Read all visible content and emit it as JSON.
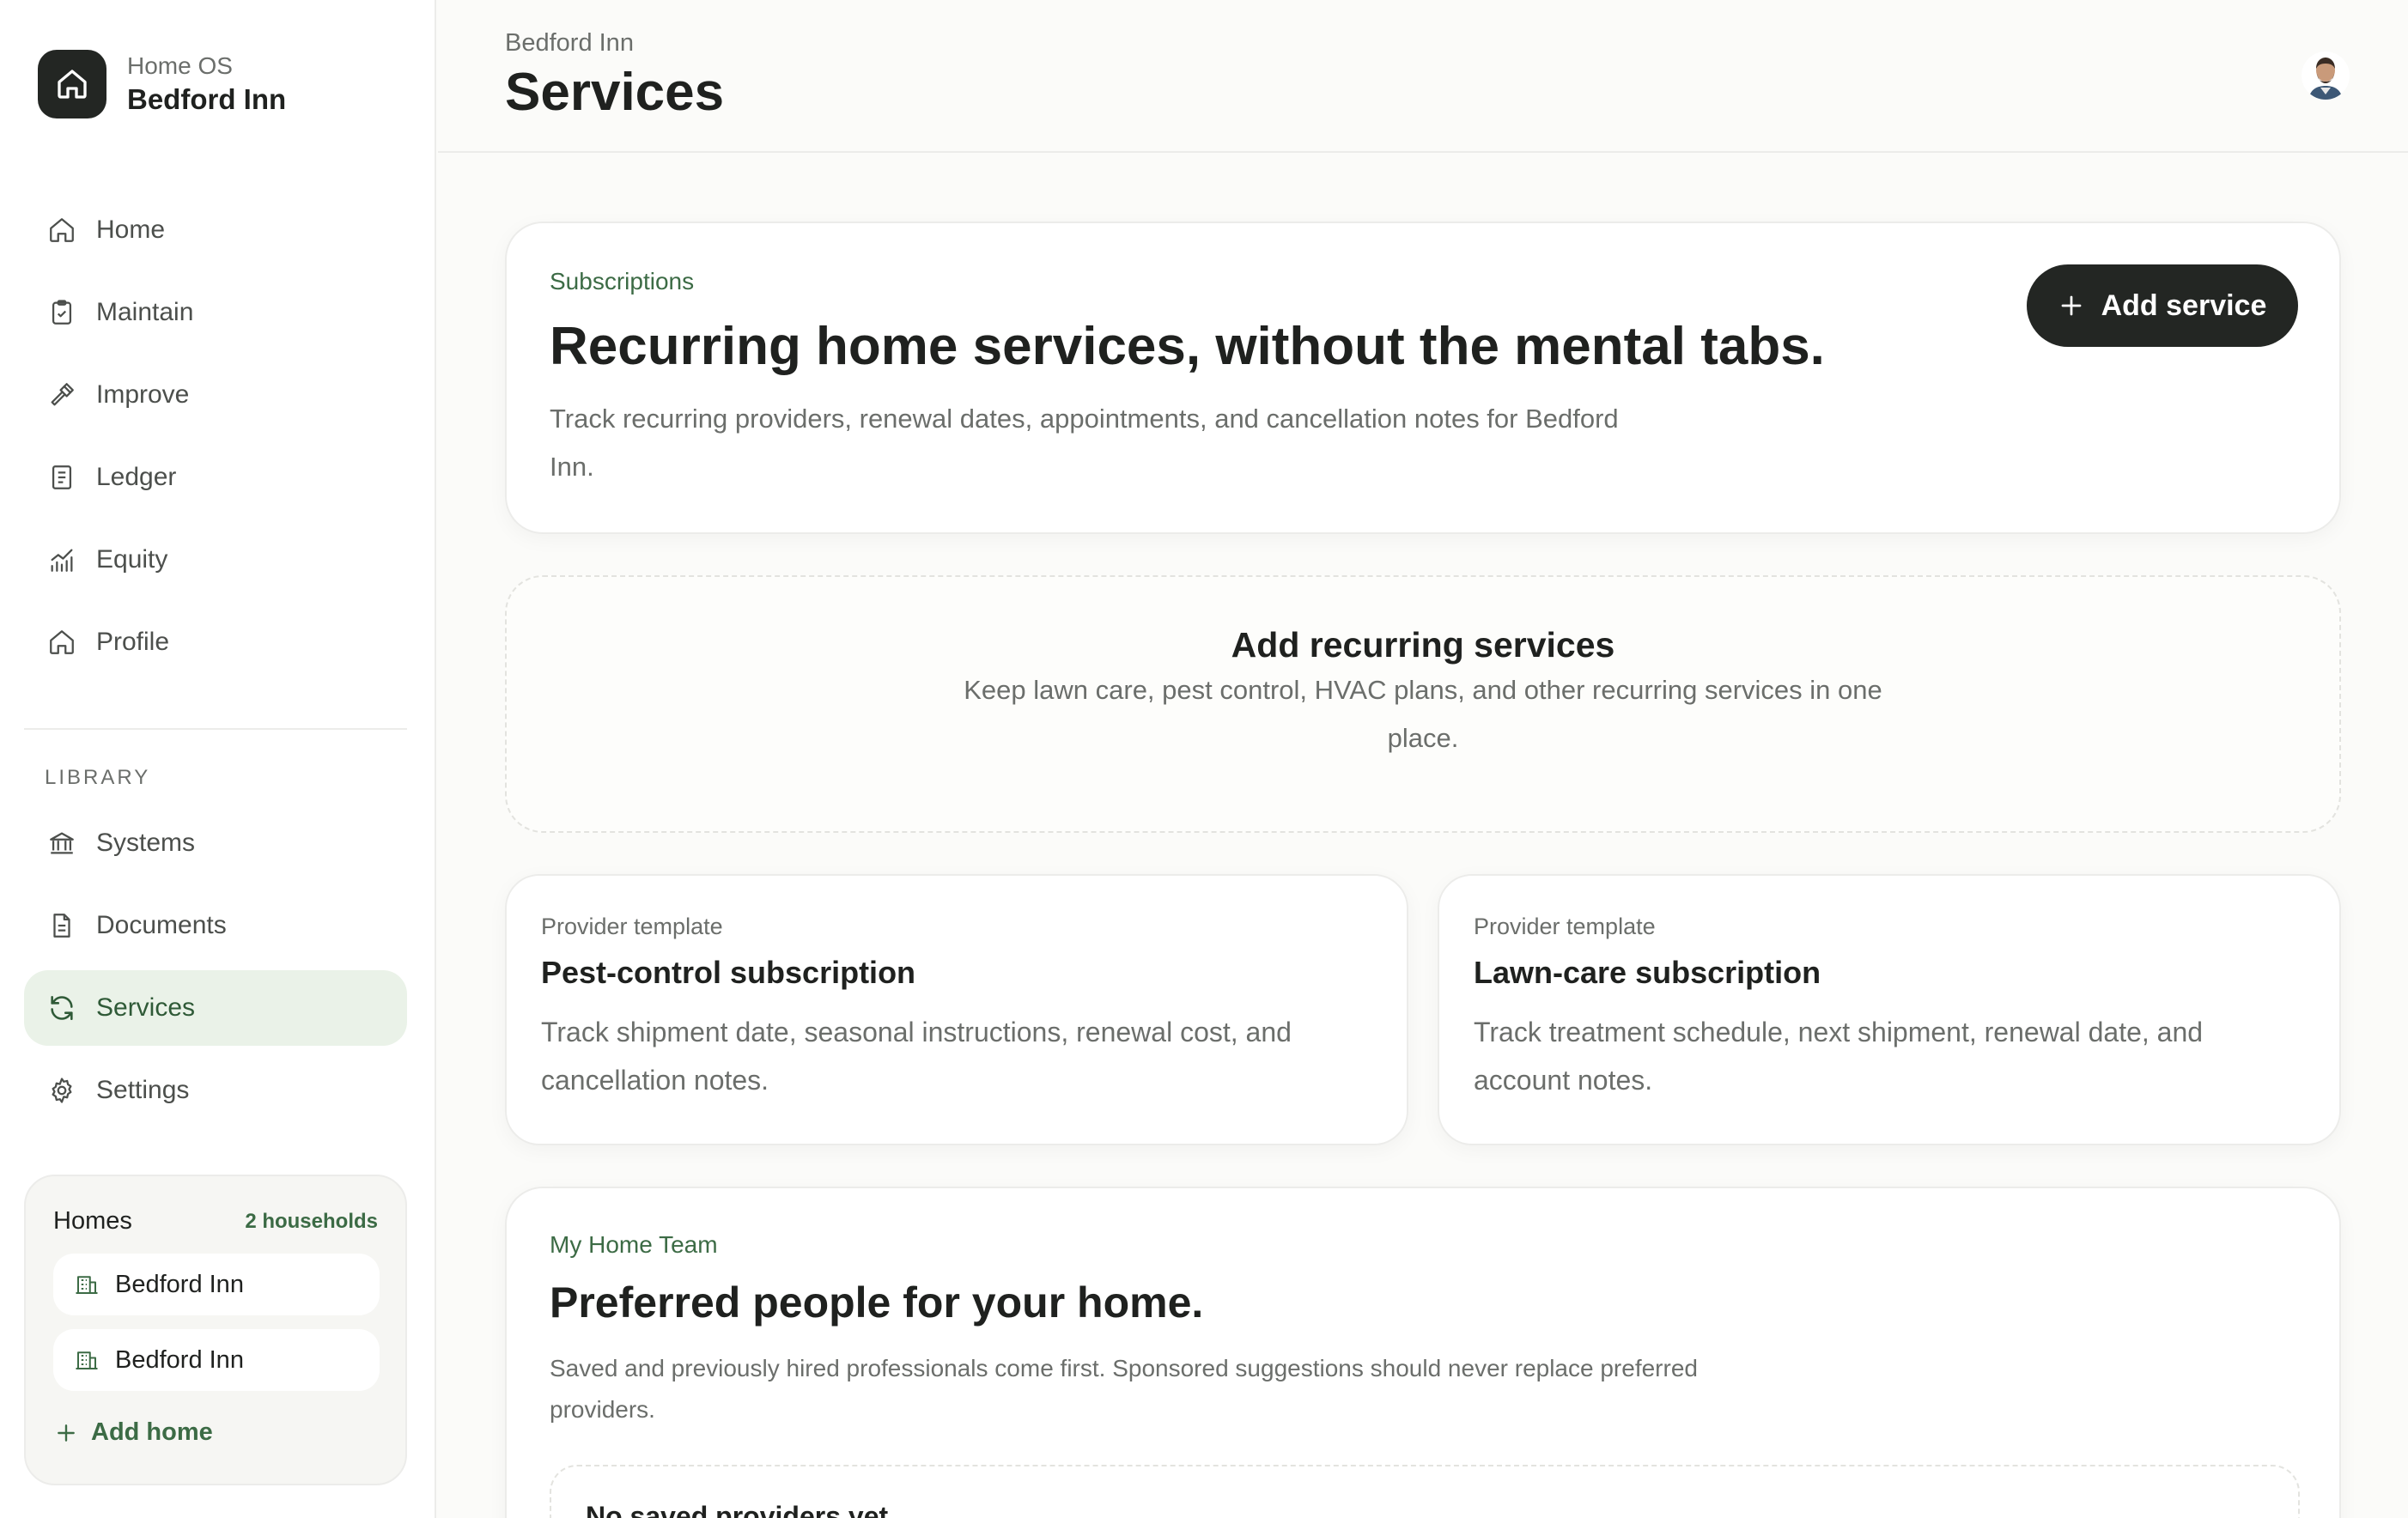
{
  "brand": {
    "eyebrow": "Home OS",
    "name": "Bedford Inn",
    "icon": "home-icon"
  },
  "nav": [
    {
      "label": "Home",
      "icon": "home-icon"
    },
    {
      "label": "Maintain",
      "icon": "clipboard-icon"
    },
    {
      "label": "Improve",
      "icon": "hammer-icon"
    },
    {
      "label": "Ledger",
      "icon": "receipt-icon"
    },
    {
      "label": "Equity",
      "icon": "chart-icon"
    },
    {
      "label": "Profile",
      "icon": "home-icon"
    }
  ],
  "library": {
    "title": "LIBRARY",
    "items": [
      {
        "label": "Systems",
        "icon": "building-columns-icon"
      },
      {
        "label": "Documents",
        "icon": "document-icon"
      },
      {
        "label": "Services",
        "icon": "refresh-icon",
        "active": true
      },
      {
        "label": "Settings",
        "icon": "gear-icon"
      }
    ]
  },
  "homes": {
    "title": "Homes",
    "count": "2 households",
    "items": [
      "Bedford Inn",
      "Bedford Inn"
    ],
    "add_label": "Add home"
  },
  "header": {
    "eyebrow": "Bedford Inn",
    "title": "Services"
  },
  "hero": {
    "eyebrow": "Subscriptions",
    "title": "Recurring home services, without the mental tabs.",
    "description": "Track recurring providers, renewal dates, appointments, and cancellation notes for Bedford Inn.",
    "button_label": "Add service"
  },
  "empty_state": {
    "title": "Add recurring services",
    "description": "Keep lawn care, pest control, HVAC plans, and other recurring services in one place."
  },
  "templates": [
    {
      "eyebrow": "Provider template",
      "title": "Pest-control subscription",
      "description": "Track shipment date, seasonal instructions, renewal cost, and cancellation notes."
    },
    {
      "eyebrow": "Provider template",
      "title": "Lawn-care subscription",
      "description": "Track treatment schedule, next shipment, renewal date, and account notes."
    }
  ],
  "team": {
    "eyebrow": "My Home Team",
    "title": "Preferred people for your home.",
    "description": "Saved and previously hired professionals come first. Sponsored suggestions should never replace preferred providers.",
    "empty_text": "No saved providers yet"
  },
  "colors": {
    "accent": "#3c6b45",
    "dark": "#232623",
    "active_bg": "#eaf2e8"
  }
}
